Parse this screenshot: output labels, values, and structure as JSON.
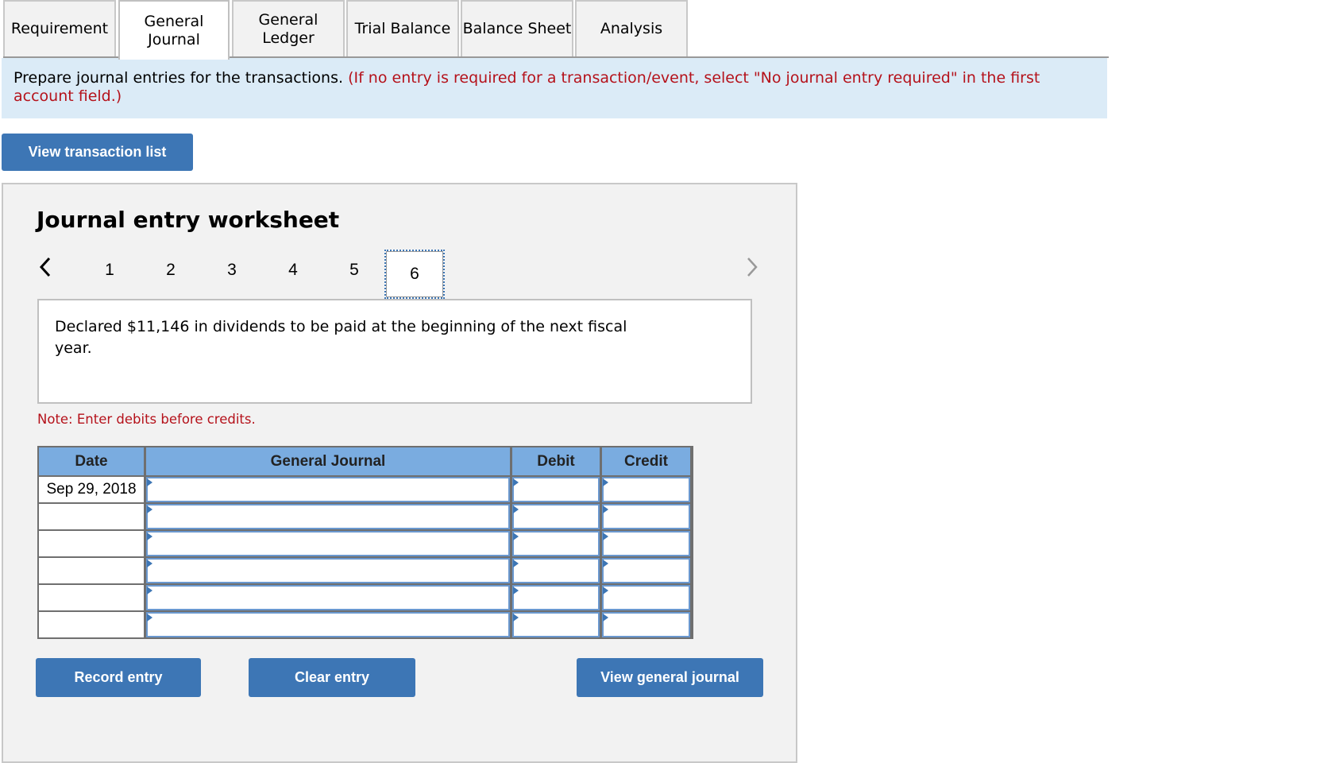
{
  "tabs": [
    {
      "label": "Requirement",
      "active": false
    },
    {
      "label": "General Journal",
      "active": true
    },
    {
      "label": "General Ledger",
      "active": false
    },
    {
      "label": "Trial Balance",
      "active": false
    },
    {
      "label": "Balance Sheet",
      "active": false
    },
    {
      "label": "Analysis",
      "active": false
    }
  ],
  "instruction": {
    "text": "Prepare journal entries for the transactions.",
    "note": "(If no entry is required for a transaction/event, select \"No journal entry required\" in the first account field.)"
  },
  "buttons": {
    "view_transaction_list": "View transaction list",
    "record_entry": "Record entry",
    "clear_entry": "Clear entry",
    "view_general_journal": "View general journal"
  },
  "worksheet": {
    "title": "Journal entry worksheet",
    "prev_icon": "‹",
    "next_icon": "›",
    "pages": [
      "1",
      "2",
      "3",
      "4",
      "5",
      "6"
    ],
    "active_page": "6",
    "description": "Declared $11,146 in dividends to be paid at the beginning of the next fiscal year.",
    "note": "Note: Enter debits before credits.",
    "table": {
      "headers": {
        "date": "Date",
        "journal": "General Journal",
        "debit": "Debit",
        "credit": "Credit"
      },
      "rows": [
        {
          "date": "Sep 29, 2018",
          "account": "",
          "debit": "",
          "credit": ""
        },
        {
          "date": "",
          "account": "",
          "debit": "",
          "credit": ""
        },
        {
          "date": "",
          "account": "",
          "debit": "",
          "credit": ""
        },
        {
          "date": "",
          "account": "",
          "debit": "",
          "credit": ""
        },
        {
          "date": "",
          "account": "",
          "debit": "",
          "credit": ""
        },
        {
          "date": "",
          "account": "",
          "debit": "",
          "credit": ""
        }
      ]
    }
  },
  "colors": {
    "accent": "#3d76b5",
    "header_blue": "#7aace0",
    "instruction_bg": "#dbebf7",
    "alert_red": "#b5121b"
  }
}
